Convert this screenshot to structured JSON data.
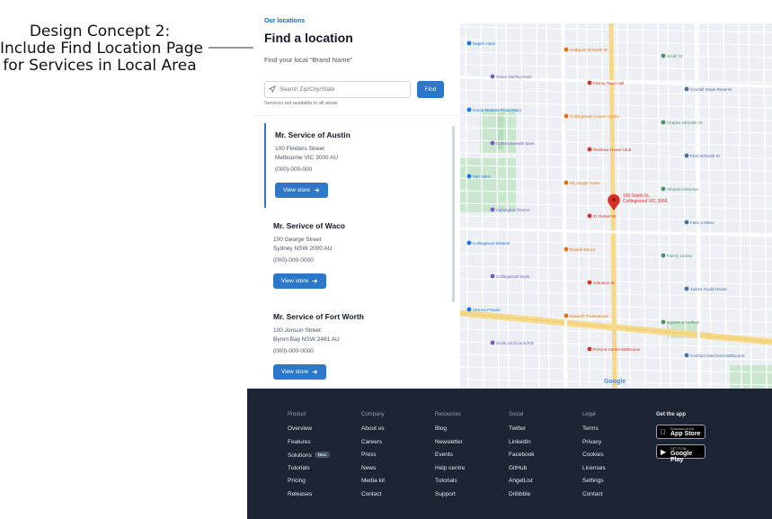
{
  "annotation": {
    "lines": [
      "Design Concept 2:",
      "Include Find Location Page",
      "for Services in Local Area"
    ]
  },
  "header": {
    "eyebrow": "Our locations",
    "title": "Find a location",
    "subtitle": "Find your local \"Brand Name\""
  },
  "search": {
    "placeholder": "Search Zip/City/State",
    "button_label": "Find",
    "note": "Services not available in all areas"
  },
  "locations": [
    {
      "name": "Mr. Service of Austin",
      "address1": "100 Flinders Street",
      "address2": "Melbourne VIC 3000 AU",
      "phone": "(000)-000-000",
      "button": "View store",
      "active": true
    },
    {
      "name": "Mr. Serivce of Waco",
      "address1": "100 George Street",
      "address2": "Sydney NSW 2000 AU",
      "phone": "(000)-000-0000",
      "button": "View store",
      "active": false
    },
    {
      "name": "Mr. Service of Fort Worth",
      "address1": "100 Jonson Street",
      "address2": "Byron Bay NSW 2481 AU",
      "phone": "(000)-000-0000",
      "button": "View store",
      "active": false
    }
  ],
  "map": {
    "attribution": "Google",
    "marker_label": [
      "100 Smith St,",
      "Collingwood VIC 3066"
    ],
    "places": [
      {
        "t": "Napier Hotel"
      },
      {
        "t": "Hodgson St/Smith St"
      },
      {
        "t": "Smith St"
      },
      {
        "t": "Grace Darling Hotel"
      },
      {
        "t": "Fitzroy Town Hall"
      },
      {
        "t": "Condell Street Reserve"
      },
      {
        "t": "Gorse Markets Proud Mary"
      },
      {
        "t": "Collingwood Leisure Centre"
      },
      {
        "t": "Charles St/Smith St"
      },
      {
        "t": "Commonwealth Bank"
      },
      {
        "t": "Rainbow House Club"
      },
      {
        "t": "Peel St/Smith St"
      },
      {
        "t": "Yah Yah's"
      },
      {
        "t": "My Jungle Home"
      },
      {
        "t": "Atherton Reserve"
      },
      {
        "t": "Alphington Fitness"
      },
      {
        "t": "21 Robert St"
      },
      {
        "t": "Fatto a Mano"
      },
      {
        "t": "Collingwood Medical"
      },
      {
        "t": "Double Deuce"
      },
      {
        "t": "Fitzroy Library"
      },
      {
        "t": "Collingwood Yards"
      },
      {
        "t": "Johnston St"
      },
      {
        "t": "James Goold House"
      },
      {
        "t": "Victoria Parade"
      },
      {
        "t": "Epworth Freemasons"
      },
      {
        "t": "Squires & Coffees"
      },
      {
        "t": "Smith St/Victoria Pde"
      },
      {
        "t": "Porcine Centre Melbourne"
      },
      {
        "t": "Comfort Hotel East Melbourne"
      }
    ]
  },
  "footer": {
    "columns": [
      {
        "heading": "Product",
        "links": [
          "Overview",
          "Features",
          "Solutions",
          "Tutorials",
          "Pricing",
          "Releases"
        ]
      },
      {
        "heading": "Company",
        "links": [
          "About us",
          "Careers",
          "Press",
          "News",
          "Media kit",
          "Contact"
        ]
      },
      {
        "heading": "Resources",
        "links": [
          "Blog",
          "Newsletter",
          "Events",
          "Help centre",
          "Tutorials",
          "Support"
        ]
      },
      {
        "heading": "Social",
        "links": [
          "Twitter",
          "LinkedIn",
          "Facebook",
          "GitHub",
          "AngelList",
          "Dribbble"
        ]
      },
      {
        "heading": "Legal",
        "links": [
          "Terms",
          "Privacy",
          "Cookies",
          "Licenses",
          "Settings",
          "Contact"
        ]
      }
    ],
    "new_badge": "New",
    "app_heading": "Get the app",
    "app_store": {
      "small": "Download on the",
      "big": "App Store"
    },
    "google_play": {
      "small": "GET IT ON",
      "big": "Google Play"
    }
  },
  "colors": {
    "accent": "#2d77c9",
    "footer_bg": "#1d2433",
    "map_road": "#f7d98a",
    "marker": "#d93025"
  }
}
